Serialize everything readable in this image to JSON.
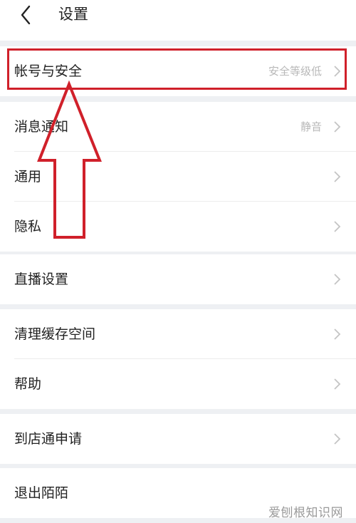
{
  "header": {
    "title": "设置",
    "back_icon": "chevron-left-icon"
  },
  "groups": [
    {
      "items": [
        {
          "label": "帐号与安全",
          "value": "安全等级低"
        }
      ]
    },
    {
      "items": [
        {
          "label": "消息通知",
          "value": "静音"
        },
        {
          "label": "通用",
          "value": ""
        },
        {
          "label": "隐私",
          "value": ""
        }
      ]
    },
    {
      "items": [
        {
          "label": "直播设置",
          "value": ""
        }
      ]
    },
    {
      "items": [
        {
          "label": "清理缓存空间",
          "value": ""
        },
        {
          "label": "帮助",
          "value": ""
        }
      ]
    },
    {
      "items": [
        {
          "label": "到店通申请",
          "value": ""
        }
      ]
    },
    {
      "items": [
        {
          "label": "退出陌陌",
          "value": ""
        }
      ]
    }
  ],
  "annotation": {
    "color": "#d0202a",
    "target": "帐号与安全"
  },
  "watermark": "爱刨根知识网",
  "colors": {
    "accent_annotation": "#d0202a",
    "chevron": "#c4c4c4",
    "value_text": "#b8b8b8"
  }
}
